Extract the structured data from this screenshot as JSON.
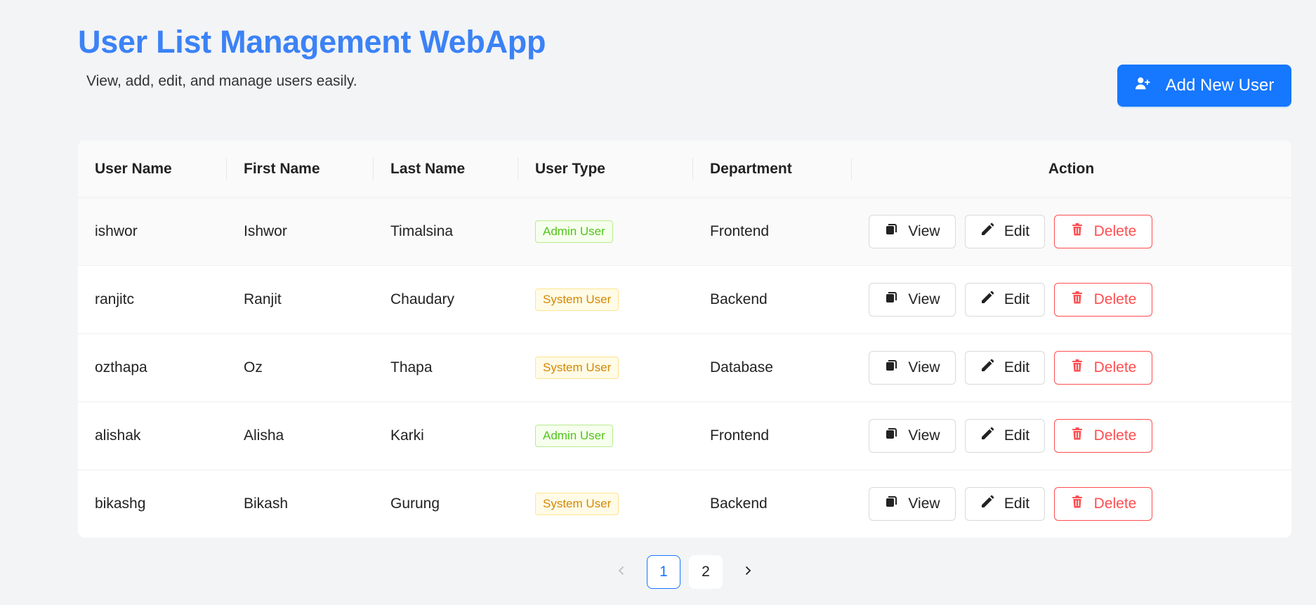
{
  "header": {
    "title": "User List Management WebApp",
    "subtitle": "View, add, edit, and manage users easily.",
    "add_button_label": "Add New User"
  },
  "table": {
    "columns": [
      "User Name",
      "First Name",
      "Last Name",
      "User Type",
      "Department",
      "Action"
    ],
    "rows": [
      {
        "username": "ishwor",
        "first": "Ishwor",
        "last": "Timalsina",
        "type": "Admin User",
        "dept": "Frontend"
      },
      {
        "username": "ranjitc",
        "first": "Ranjit",
        "last": "Chaudary",
        "type": "System User",
        "dept": "Backend"
      },
      {
        "username": "ozthapa",
        "first": "Oz",
        "last": "Thapa",
        "type": "System User",
        "dept": "Database"
      },
      {
        "username": "alishak",
        "first": "Alisha",
        "last": "Karki",
        "type": "Admin User",
        "dept": "Frontend"
      },
      {
        "username": "bikashg",
        "first": "Bikash",
        "last": "Gurung",
        "type": "System User",
        "dept": "Backend"
      }
    ],
    "actions": {
      "view": "View",
      "edit": "Edit",
      "delete": "Delete"
    }
  },
  "pagination": {
    "pages": [
      "1",
      "2"
    ],
    "current": "1"
  },
  "colors": {
    "accent": "#1677ff",
    "title": "#3b82f6",
    "danger": "#ff4d4f",
    "admin_tag": "#52c41a",
    "system_tag": "#d48806"
  }
}
